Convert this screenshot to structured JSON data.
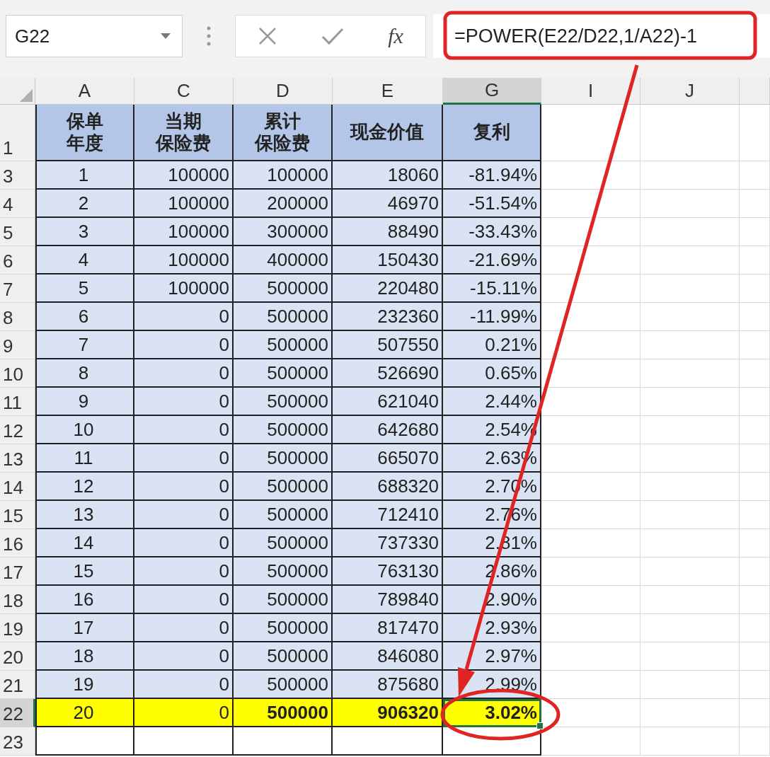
{
  "name_box": {
    "value": "G22"
  },
  "formula_bar": {
    "fx_label": "fx",
    "formula": "=POWER(E22/D22,1/A22)-1"
  },
  "columns": [
    {
      "label": "A",
      "selected": false
    },
    {
      "label": "C",
      "selected": false
    },
    {
      "label": "D",
      "selected": false
    },
    {
      "label": "E",
      "selected": false
    },
    {
      "label": "G",
      "selected": true
    },
    {
      "label": "I",
      "selected": false
    },
    {
      "label": "J",
      "selected": false
    }
  ],
  "header_row": {
    "row": "1",
    "cells": [
      [
        "保单",
        "年度"
      ],
      [
        "当期",
        "保险费"
      ],
      [
        "累计",
        "保险费"
      ],
      [
        "现金价值"
      ],
      [
        "复利"
      ]
    ]
  },
  "rows": [
    {
      "row": "3",
      "highlighted": false,
      "selected": false,
      "cells": [
        {
          "text": "1",
          "bold": false
        },
        {
          "text": "100000",
          "bold": false
        },
        {
          "text": "100000",
          "bold": false
        },
        {
          "text": "18060",
          "bold": false
        },
        {
          "text": "-81.94%",
          "bold": false
        }
      ]
    },
    {
      "row": "4",
      "highlighted": false,
      "selected": false,
      "cells": [
        {
          "text": "2",
          "bold": false
        },
        {
          "text": "100000",
          "bold": false
        },
        {
          "text": "200000",
          "bold": false
        },
        {
          "text": "46970",
          "bold": false
        },
        {
          "text": "-51.54%",
          "bold": false
        }
      ]
    },
    {
      "row": "5",
      "highlighted": false,
      "selected": false,
      "cells": [
        {
          "text": "3",
          "bold": false
        },
        {
          "text": "100000",
          "bold": false
        },
        {
          "text": "300000",
          "bold": false
        },
        {
          "text": "88490",
          "bold": false
        },
        {
          "text": "-33.43%",
          "bold": false
        }
      ]
    },
    {
      "row": "6",
      "highlighted": false,
      "selected": false,
      "cells": [
        {
          "text": "4",
          "bold": false
        },
        {
          "text": "100000",
          "bold": false
        },
        {
          "text": "400000",
          "bold": false
        },
        {
          "text": "150430",
          "bold": false
        },
        {
          "text": "-21.69%",
          "bold": false
        }
      ]
    },
    {
      "row": "7",
      "highlighted": false,
      "selected": false,
      "cells": [
        {
          "text": "5",
          "bold": false
        },
        {
          "text": "100000",
          "bold": false
        },
        {
          "text": "500000",
          "bold": false
        },
        {
          "text": "220480",
          "bold": false
        },
        {
          "text": "-15.11%",
          "bold": false
        }
      ]
    },
    {
      "row": "8",
      "highlighted": false,
      "selected": false,
      "cells": [
        {
          "text": "6",
          "bold": false
        },
        {
          "text": "0",
          "bold": false
        },
        {
          "text": "500000",
          "bold": false
        },
        {
          "text": "232360",
          "bold": false
        },
        {
          "text": "-11.99%",
          "bold": false
        }
      ]
    },
    {
      "row": "9",
      "highlighted": false,
      "selected": false,
      "cells": [
        {
          "text": "7",
          "bold": false
        },
        {
          "text": "0",
          "bold": false
        },
        {
          "text": "500000",
          "bold": false
        },
        {
          "text": "507550",
          "bold": false
        },
        {
          "text": "0.21%",
          "bold": false
        }
      ]
    },
    {
      "row": "10",
      "highlighted": false,
      "selected": false,
      "cells": [
        {
          "text": "8",
          "bold": false
        },
        {
          "text": "0",
          "bold": false
        },
        {
          "text": "500000",
          "bold": false
        },
        {
          "text": "526690",
          "bold": false
        },
        {
          "text": "0.65%",
          "bold": false
        }
      ]
    },
    {
      "row": "11",
      "highlighted": false,
      "selected": false,
      "cells": [
        {
          "text": "9",
          "bold": false
        },
        {
          "text": "0",
          "bold": false
        },
        {
          "text": "500000",
          "bold": false
        },
        {
          "text": "621040",
          "bold": false
        },
        {
          "text": "2.44%",
          "bold": false
        }
      ]
    },
    {
      "row": "12",
      "highlighted": false,
      "selected": false,
      "cells": [
        {
          "text": "10",
          "bold": false
        },
        {
          "text": "0",
          "bold": false
        },
        {
          "text": "500000",
          "bold": false
        },
        {
          "text": "642680",
          "bold": false
        },
        {
          "text": "2.54%",
          "bold": false
        }
      ]
    },
    {
      "row": "13",
      "highlighted": false,
      "selected": false,
      "cells": [
        {
          "text": "11",
          "bold": false
        },
        {
          "text": "0",
          "bold": false
        },
        {
          "text": "500000",
          "bold": false
        },
        {
          "text": "665070",
          "bold": false
        },
        {
          "text": "2.63%",
          "bold": false
        }
      ]
    },
    {
      "row": "14",
      "highlighted": false,
      "selected": false,
      "cells": [
        {
          "text": "12",
          "bold": false
        },
        {
          "text": "0",
          "bold": false
        },
        {
          "text": "500000",
          "bold": false
        },
        {
          "text": "688320",
          "bold": false
        },
        {
          "text": "2.70%",
          "bold": false
        }
      ]
    },
    {
      "row": "15",
      "highlighted": false,
      "selected": false,
      "cells": [
        {
          "text": "13",
          "bold": false
        },
        {
          "text": "0",
          "bold": false
        },
        {
          "text": "500000",
          "bold": false
        },
        {
          "text": "712410",
          "bold": false
        },
        {
          "text": "2.76%",
          "bold": false
        }
      ]
    },
    {
      "row": "16",
      "highlighted": false,
      "selected": false,
      "cells": [
        {
          "text": "14",
          "bold": false
        },
        {
          "text": "0",
          "bold": false
        },
        {
          "text": "500000",
          "bold": false
        },
        {
          "text": "737330",
          "bold": false
        },
        {
          "text": "2.81%",
          "bold": false
        }
      ]
    },
    {
      "row": "17",
      "highlighted": false,
      "selected": false,
      "cells": [
        {
          "text": "15",
          "bold": false
        },
        {
          "text": "0",
          "bold": false
        },
        {
          "text": "500000",
          "bold": false
        },
        {
          "text": "763130",
          "bold": false
        },
        {
          "text": "2.86%",
          "bold": false
        }
      ]
    },
    {
      "row": "18",
      "highlighted": false,
      "selected": false,
      "cells": [
        {
          "text": "16",
          "bold": false
        },
        {
          "text": "0",
          "bold": false
        },
        {
          "text": "500000",
          "bold": false
        },
        {
          "text": "789840",
          "bold": false
        },
        {
          "text": "2.90%",
          "bold": false
        }
      ]
    },
    {
      "row": "19",
      "highlighted": false,
      "selected": false,
      "cells": [
        {
          "text": "17",
          "bold": false
        },
        {
          "text": "0",
          "bold": false
        },
        {
          "text": "500000",
          "bold": false
        },
        {
          "text": "817470",
          "bold": false
        },
        {
          "text": "2.93%",
          "bold": false
        }
      ]
    },
    {
      "row": "20",
      "highlighted": false,
      "selected": false,
      "cells": [
        {
          "text": "18",
          "bold": false
        },
        {
          "text": "0",
          "bold": false
        },
        {
          "text": "500000",
          "bold": false
        },
        {
          "text": "846080",
          "bold": false
        },
        {
          "text": "2.97%",
          "bold": false
        }
      ]
    },
    {
      "row": "21",
      "highlighted": false,
      "selected": false,
      "cells": [
        {
          "text": "19",
          "bold": false
        },
        {
          "text": "0",
          "bold": false
        },
        {
          "text": "500000",
          "bold": false
        },
        {
          "text": "875680",
          "bold": false
        },
        {
          "text": "2.99%",
          "bold": false
        }
      ]
    },
    {
      "row": "22",
      "highlighted": true,
      "selected": true,
      "cells": [
        {
          "text": "20",
          "bold": false
        },
        {
          "text": "0",
          "bold": false
        },
        {
          "text": "500000",
          "bold": true
        },
        {
          "text": "906320",
          "bold": true
        },
        {
          "text": "3.02%",
          "bold": true
        }
      ]
    },
    {
      "row": "23",
      "highlighted": false,
      "selected": false
    }
  ]
}
